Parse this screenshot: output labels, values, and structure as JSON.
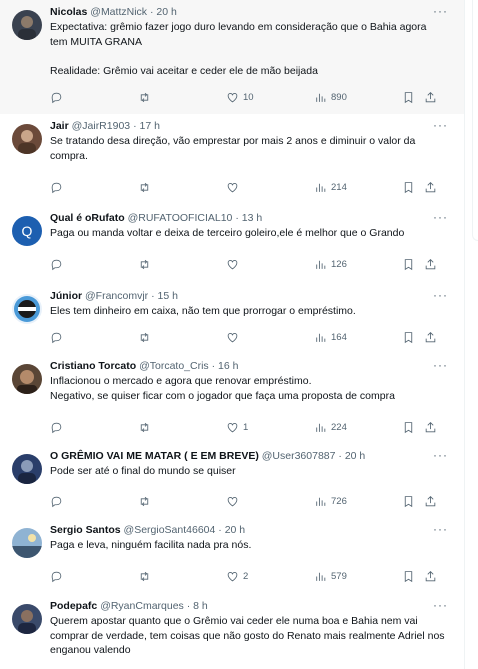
{
  "tweets": [
    {
      "name": "Nicolas",
      "handle": "@MattzNick",
      "time": "20 h",
      "text": "Expectativa: grêmio fazer jogo duro levando em consideração que o Bahia agora tem MUITA GRANA\n\nRealidade: Grêmio vai aceitar e ceder ele de mão beijada",
      "replies": "",
      "retweets": "",
      "likes": "10",
      "views": "890",
      "avatar_color": "#3a4250"
    },
    {
      "name": "Jair",
      "handle": "@JairR1903",
      "time": "17 h",
      "text": "Se tratando desa direção, vão emprestar por mais 2 anos e diminuir o valor da compra.",
      "replies": "",
      "retweets": "",
      "likes": "",
      "views": "214",
      "avatar_color": "#6b4a3a"
    },
    {
      "name": "Qual é oRufato",
      "handle": "@RUFATOOFICIAL10",
      "time": "13 h",
      "text": "Paga ou manda voltar e deixa de terceiro goleiro,ele é melhor que o Grando",
      "replies": "",
      "retweets": "",
      "likes": "",
      "views": "126",
      "avatar_color": "#1d5fb0",
      "avatar_letter": "Q"
    },
    {
      "name": "Júnior",
      "handle": "@Francomvjr",
      "time": "15 h",
      "text": "Eles tem dinheiro em caixa, não tem que prorrogar o empréstimo.",
      "replies": "",
      "retweets": "",
      "likes": "",
      "views": "164",
      "avatar_color": "#4a9ad8"
    },
    {
      "name": "Cristiano Torcato",
      "handle": "@Torcato_Cris",
      "time": "16 h",
      "text": "Inflacionou o mercado e agora que renovar empréstimo.\nNegativo, se quiser ficar com o jogador que faça uma proposta de compra",
      "replies": "",
      "retweets": "",
      "likes": "1",
      "views": "224",
      "avatar_color": "#5a4636"
    },
    {
      "name": "O GRÊMIO VAI ME MATAR ( E EM BREVE)",
      "handle": "@User3607887",
      "time": "20 h",
      "text": "Pode ser até o final do mundo se quiser",
      "replies": "",
      "retweets": "",
      "likes": "",
      "views": "726",
      "avatar_color": "#2a3e6a"
    },
    {
      "name": "Sergio Santos",
      "handle": "@SergioSant46604",
      "time": "20 h",
      "text": "Paga e leva, ninguém facilita nada pra nós.",
      "replies": "",
      "retweets": "",
      "likes": "2",
      "views": "579",
      "avatar_color": "#4a6a8a"
    },
    {
      "name": "Podepafc",
      "handle": "@RyanCmarques",
      "time": "8 h",
      "text": "Querem apostar quanto que o Grêmio vai ceder ele numa boa e Bahia nem vai comprar de verdade, tem coisas que não gosto do Renato mais realmente Adriel nos enganou valendo",
      "replies": "",
      "retweets": "",
      "likes": "",
      "views": "",
      "avatar_color": "#3a4a6a"
    }
  ],
  "icons": [
    "reply-icon",
    "retweet-icon",
    "like-icon",
    "views-icon",
    "bookmark-icon",
    "share-icon",
    "more-icon"
  ]
}
